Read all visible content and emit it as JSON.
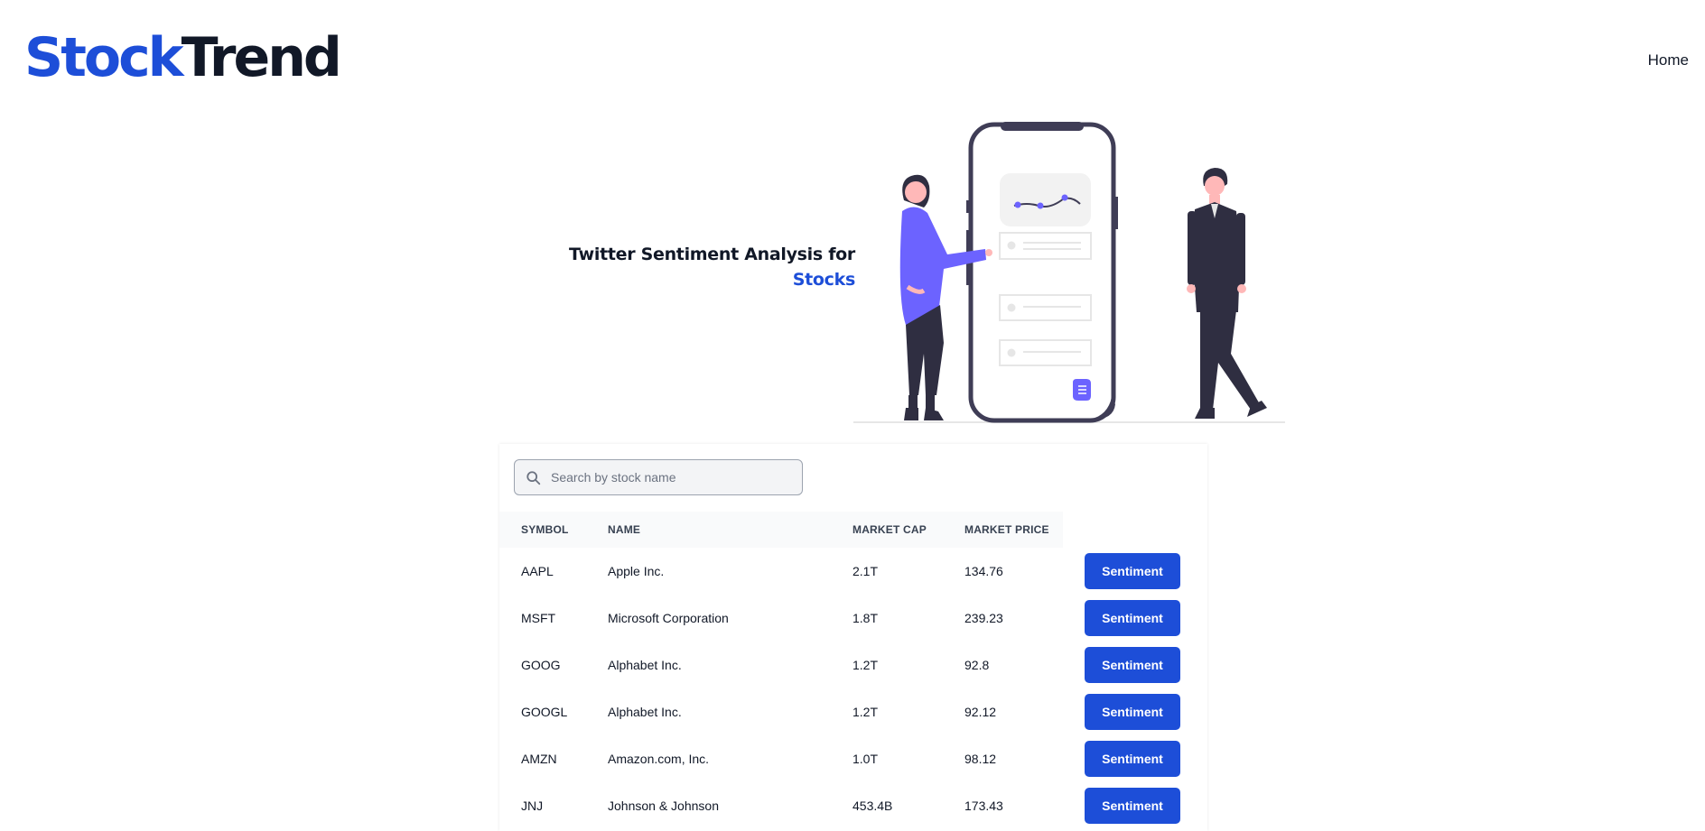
{
  "header": {
    "logo_part1": "Stock",
    "logo_part2": "Trend",
    "nav_home": "Home"
  },
  "hero": {
    "title_line1": "Twitter Sentiment Analysis for",
    "title_line2": "Stocks",
    "illustration_icon": "people-phone-chart-illustration"
  },
  "search": {
    "placeholder": "Search by stock name",
    "value": "",
    "icon": "search-icon"
  },
  "table": {
    "headers": {
      "symbol": "SYMBOL",
      "name": "NAME",
      "market_cap": "MARKET CAP",
      "market_price": "MARKET PRICE"
    },
    "rows": [
      {
        "symbol": "AAPL",
        "name": "Apple Inc.",
        "market_cap": "2.1T",
        "market_price": "134.76",
        "action": "Sentiment"
      },
      {
        "symbol": "MSFT",
        "name": "Microsoft Corporation",
        "market_cap": "1.8T",
        "market_price": "239.23",
        "action": "Sentiment"
      },
      {
        "symbol": "GOOG",
        "name": "Alphabet Inc.",
        "market_cap": "1.2T",
        "market_price": "92.8",
        "action": "Sentiment"
      },
      {
        "symbol": "GOOGL",
        "name": "Alphabet Inc.",
        "market_cap": "1.2T",
        "market_price": "92.12",
        "action": "Sentiment"
      },
      {
        "symbol": "AMZN",
        "name": "Amazon.com, Inc.",
        "market_cap": "1.0T",
        "market_price": "98.12",
        "action": "Sentiment"
      },
      {
        "symbol": "JNJ",
        "name": "Johnson & Johnson",
        "market_cap": "453.4B",
        "market_price": "173.43",
        "action": "Sentiment"
      }
    ]
  },
  "colors": {
    "brand_blue": "#1d4ed8",
    "text_dark": "#111827",
    "accent_purple": "#6c63ff"
  }
}
